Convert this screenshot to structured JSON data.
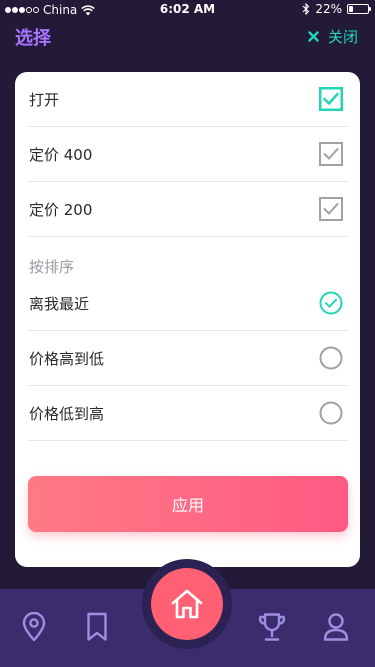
{
  "status_bar": {
    "carrier": "China",
    "time": "6:02 AM",
    "battery": "22%",
    "battery_level": 0.22
  },
  "header": {
    "title": "选择",
    "close_label": "关闭"
  },
  "filters": [
    {
      "label": "打开",
      "checked": true
    },
    {
      "label": "定价 400",
      "checked": false
    },
    {
      "label": "定价 200",
      "checked": false
    }
  ],
  "sort": {
    "section_label": "按排序",
    "options": [
      {
        "label": "离我最近",
        "selected": true
      },
      {
        "label": "价格高到低",
        "selected": false
      },
      {
        "label": "价格低到高",
        "selected": false
      }
    ]
  },
  "apply_label": "应用",
  "tabbar": {
    "items": [
      "location-icon",
      "bookmark-icon",
      "home-icon",
      "trophy-icon",
      "user-icon"
    ],
    "active": "home-icon"
  },
  "colors": {
    "background": "#231a38",
    "accent_purple": "#a774ff",
    "accent_teal": "#23d5b4",
    "button_pink": "#ff5a83",
    "tabbar": "#3b2d6d",
    "unchecked_gray": "#a0a0a8"
  }
}
